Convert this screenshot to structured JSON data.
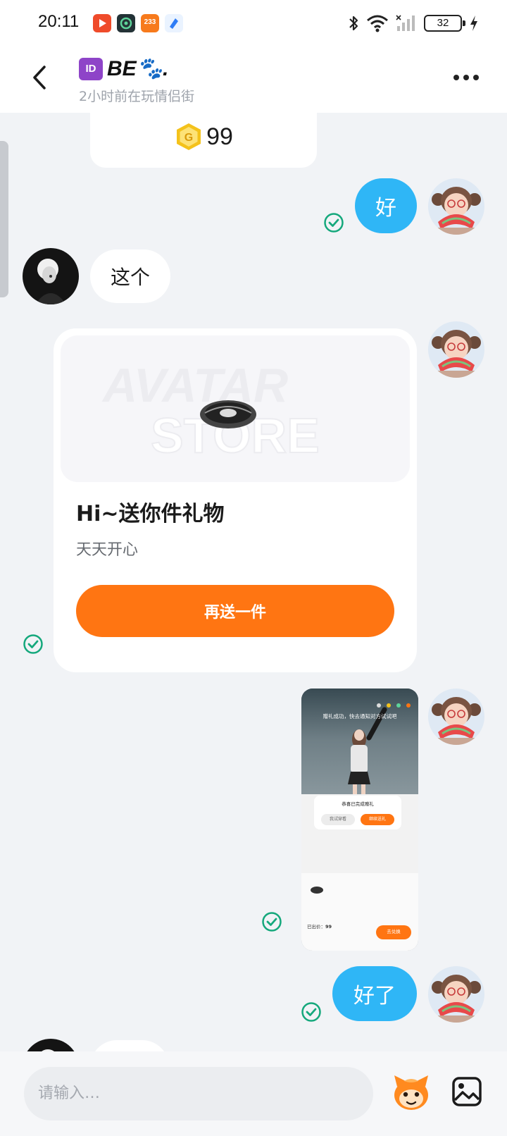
{
  "status_bar": {
    "time": "20:11",
    "app_icons": [
      "video-app-icon",
      "game-box-icon",
      "app-233-icon",
      "blue-app-icon"
    ],
    "app_233_label": "233",
    "battery": "32"
  },
  "header": {
    "id_badge": "ID",
    "title": "BE🐾.",
    "subtitle": "2小时前在玩情侣街"
  },
  "messages": {
    "coin_amount": "99",
    "reply_ok": "好",
    "incoming_this": "这个",
    "gift_card": {
      "title": "Hi~送你件礼物",
      "subtitle": "天天开心",
      "button": "再送一件"
    },
    "reply_done": "好了"
  },
  "screenshot_thumb": {
    "banner": "赠礼成功，快去通知对方试试吧",
    "dialog_title": "恭喜已完成赠礼",
    "dialog_left": "我试穿看",
    "dialog_right": "继续送礼",
    "price_label": "已出价：",
    "price_value": "99",
    "confirm": "去兑换"
  },
  "input": {
    "placeholder": "请输入…"
  },
  "colors": {
    "accent_orange": "#ff7512",
    "bubble_blue": "#2fb6f6",
    "read_check": "#15a87c"
  }
}
